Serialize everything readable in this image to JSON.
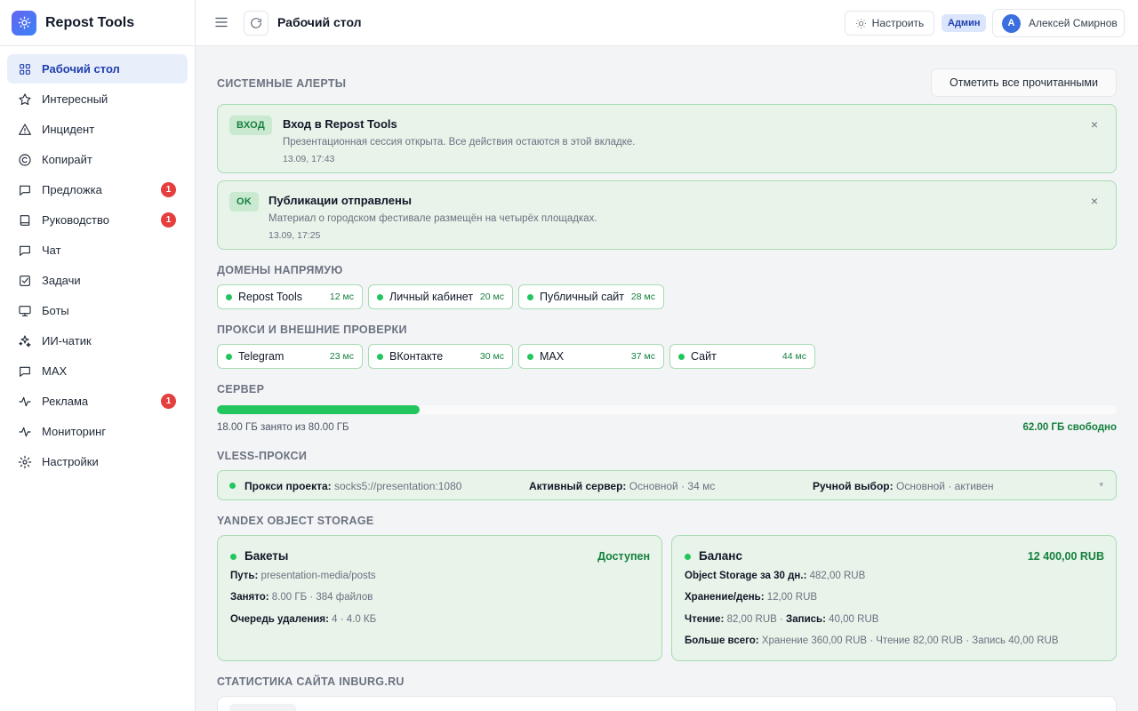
{
  "app": {
    "name": "Repost Tools"
  },
  "sidebar": {
    "items": [
      {
        "label": "Рабочий стол",
        "icon": "grid-icon",
        "active": true,
        "badge": ""
      },
      {
        "label": "Интересный",
        "icon": "star-icon",
        "badge": ""
      },
      {
        "label": "Инцидент",
        "icon": "warning-icon",
        "badge": ""
      },
      {
        "label": "Копирайт",
        "icon": "copyright-icon",
        "badge": ""
      },
      {
        "label": "Предложка",
        "icon": "message-icon",
        "badge": "1"
      },
      {
        "label": "Руководство",
        "icon": "book-icon",
        "badge": "1"
      },
      {
        "label": "Чат",
        "icon": "chat-icon",
        "badge": ""
      },
      {
        "label": "Задачи",
        "icon": "checkbox-icon",
        "badge": ""
      },
      {
        "label": "Боты",
        "icon": "monitor-icon",
        "badge": ""
      },
      {
        "label": "ИИ-чатик",
        "icon": "sparkles-icon",
        "badge": ""
      },
      {
        "label": "MAX",
        "icon": "message-icon",
        "badge": ""
      },
      {
        "label": "Реклама",
        "icon": "activity-icon",
        "badge": "1"
      },
      {
        "label": "Мониторинг",
        "icon": "activity-icon",
        "badge": ""
      },
      {
        "label": "Настройки",
        "icon": "gear-icon",
        "badge": ""
      }
    ]
  },
  "header": {
    "title": "Рабочий стол",
    "configure_label": "Настроить",
    "role": "Админ",
    "user_initial": "А",
    "user_name": "Алексей Смирнов"
  },
  "alerts": {
    "section_title": "Системные алерты",
    "mark_all_label": "Отметить все прочитанными",
    "items": [
      {
        "tag": "ВХОД",
        "title": "Вход в Repost Tools",
        "text": "Презентационная сессия открыта. Все действия остаются в этой вкладке.",
        "time": "13.09, 17:43"
      },
      {
        "tag": "OK",
        "title": "Публикации отправлены",
        "text": "Материал о городском фестивале размещён на четырёх площадках.",
        "time": "13.09, 17:25"
      }
    ]
  },
  "domains": {
    "section_title": "Домены напрямую",
    "items": [
      {
        "name": "Repost Tools",
        "ms": "12 мс"
      },
      {
        "name": "Личный кабинет",
        "ms": "20 мс"
      },
      {
        "name": "Публичный сайт",
        "ms": "28 мс"
      }
    ]
  },
  "proxies": {
    "section_title": "Прокси и внешние проверки",
    "items": [
      {
        "name": "Telegram",
        "ms": "23 мс"
      },
      {
        "name": "ВКонтакте",
        "ms": "30 мс"
      },
      {
        "name": "MAX",
        "ms": "37 мс"
      },
      {
        "name": "Сайт",
        "ms": "44 мс"
      }
    ]
  },
  "server": {
    "section_title": "Сервер",
    "used_fraction": 0.225,
    "used_text": "18.00 ГБ занято из 80.00 ГБ",
    "free_text": "62.00 ГБ свободно"
  },
  "vless": {
    "section_title": "VLESS-прокси",
    "project_label": "Прокси проекта:",
    "project_value": "socks5://presentation:1080",
    "active_label": "Активный сервер:",
    "active_value": "Основной · 34 мс",
    "manual_label": "Ручной выбор:",
    "manual_value": "Основной · активен"
  },
  "storage": {
    "section_title": "Yandex Object Storage",
    "buckets": {
      "title": "Бакеты",
      "status": "Доступен",
      "path_label": "Путь:",
      "path_value": "presentation-media/posts",
      "used_label": "Занято:",
      "used_value": "8.00 ГБ · 384 файлов",
      "queue_label": "Очередь удаления:",
      "queue_value": "4 · 4.0 КБ"
    },
    "balance": {
      "title": "Баланс",
      "amount": "12 400,00 RUB",
      "os30_label": "Object Storage за 30 дн.:",
      "os30_value": "482,00 RUB",
      "storage_day_label": "Хранение/день:",
      "storage_day_value": "12,00 RUB",
      "read_label": "Чтение:",
      "read_value": "82,00 RUB · ",
      "write_label": "Запись:",
      "write_value": "40,00 RUB",
      "most_label": "Больше всего:",
      "most_value": "Хранение 360,00 RUB · Чтение 82,00 RUB · Запись 40,00 RUB"
    }
  },
  "site_stats": {
    "section_title": "Статистика сайта inburg.ru"
  },
  "colors": {
    "accent": "#1e40af",
    "success": "#22c55e",
    "badge": "#e53e3e"
  }
}
